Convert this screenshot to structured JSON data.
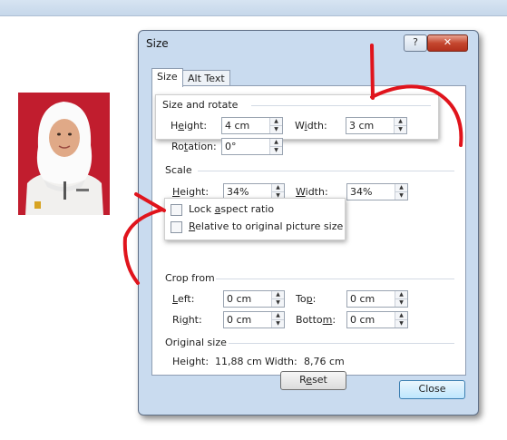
{
  "dialog": {
    "title": "Size",
    "help_label": "?",
    "close_label": "✕",
    "tabs": [
      {
        "label": "Size",
        "active": true
      },
      {
        "label": "Alt Text",
        "active": false
      }
    ],
    "size_and_rotate": {
      "header": "Size and rotate",
      "height_label": "Height:",
      "height_value": "4 cm",
      "width_label": "Width:",
      "width_value": "3 cm",
      "rotation_label": "Rotation:",
      "rotation_value": "0°"
    },
    "scale": {
      "header": "Scale",
      "height_label": "Height:",
      "height_value": "34%",
      "width_label": "Width:",
      "width_value": "34%",
      "lock_aspect_label": "Lock aspect ratio",
      "lock_aspect_checked": false,
      "relative_label": "Relative to original picture size",
      "relative_checked": false
    },
    "crop_from": {
      "header": "Crop from",
      "left_label": "Left:",
      "left_value": "0 cm",
      "top_label": "Top:",
      "top_value": "0 cm",
      "right_label": "Right:",
      "right_value": "0 cm",
      "bottom_label": "Bottom:",
      "bottom_value": "0 cm"
    },
    "original_size": {
      "header": "Original size",
      "height_label": "Height:",
      "height_value": "11,88 cm",
      "width_label": "Width:",
      "width_value": "8,76 cm",
      "reset_label": "Reset"
    },
    "close_button_label": "Close"
  },
  "colors": {
    "dialog_frame": "#c9dbef",
    "annotation_red": "#e0141c",
    "photo_background": "#c11d2e"
  }
}
